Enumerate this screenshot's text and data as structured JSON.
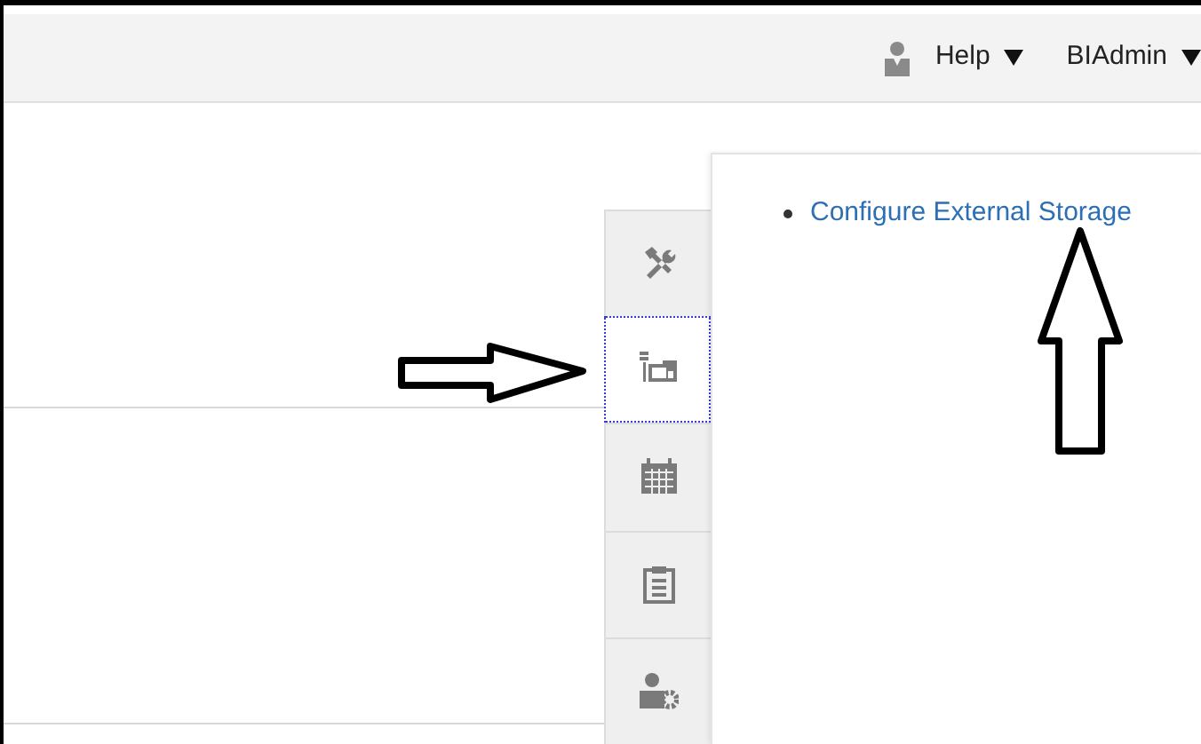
{
  "header": {
    "menus": [
      {
        "label": "Help"
      },
      {
        "label": "BIAdmin"
      }
    ]
  },
  "side_tabs": [
    {
      "kind": "tools",
      "selected": false
    },
    {
      "kind": "storage",
      "selected": true
    },
    {
      "kind": "calendar",
      "selected": false
    },
    {
      "kind": "clipboard",
      "selected": false
    },
    {
      "kind": "user-settings",
      "selected": false
    }
  ],
  "panel": {
    "links": [
      "Configure External Storage"
    ]
  }
}
